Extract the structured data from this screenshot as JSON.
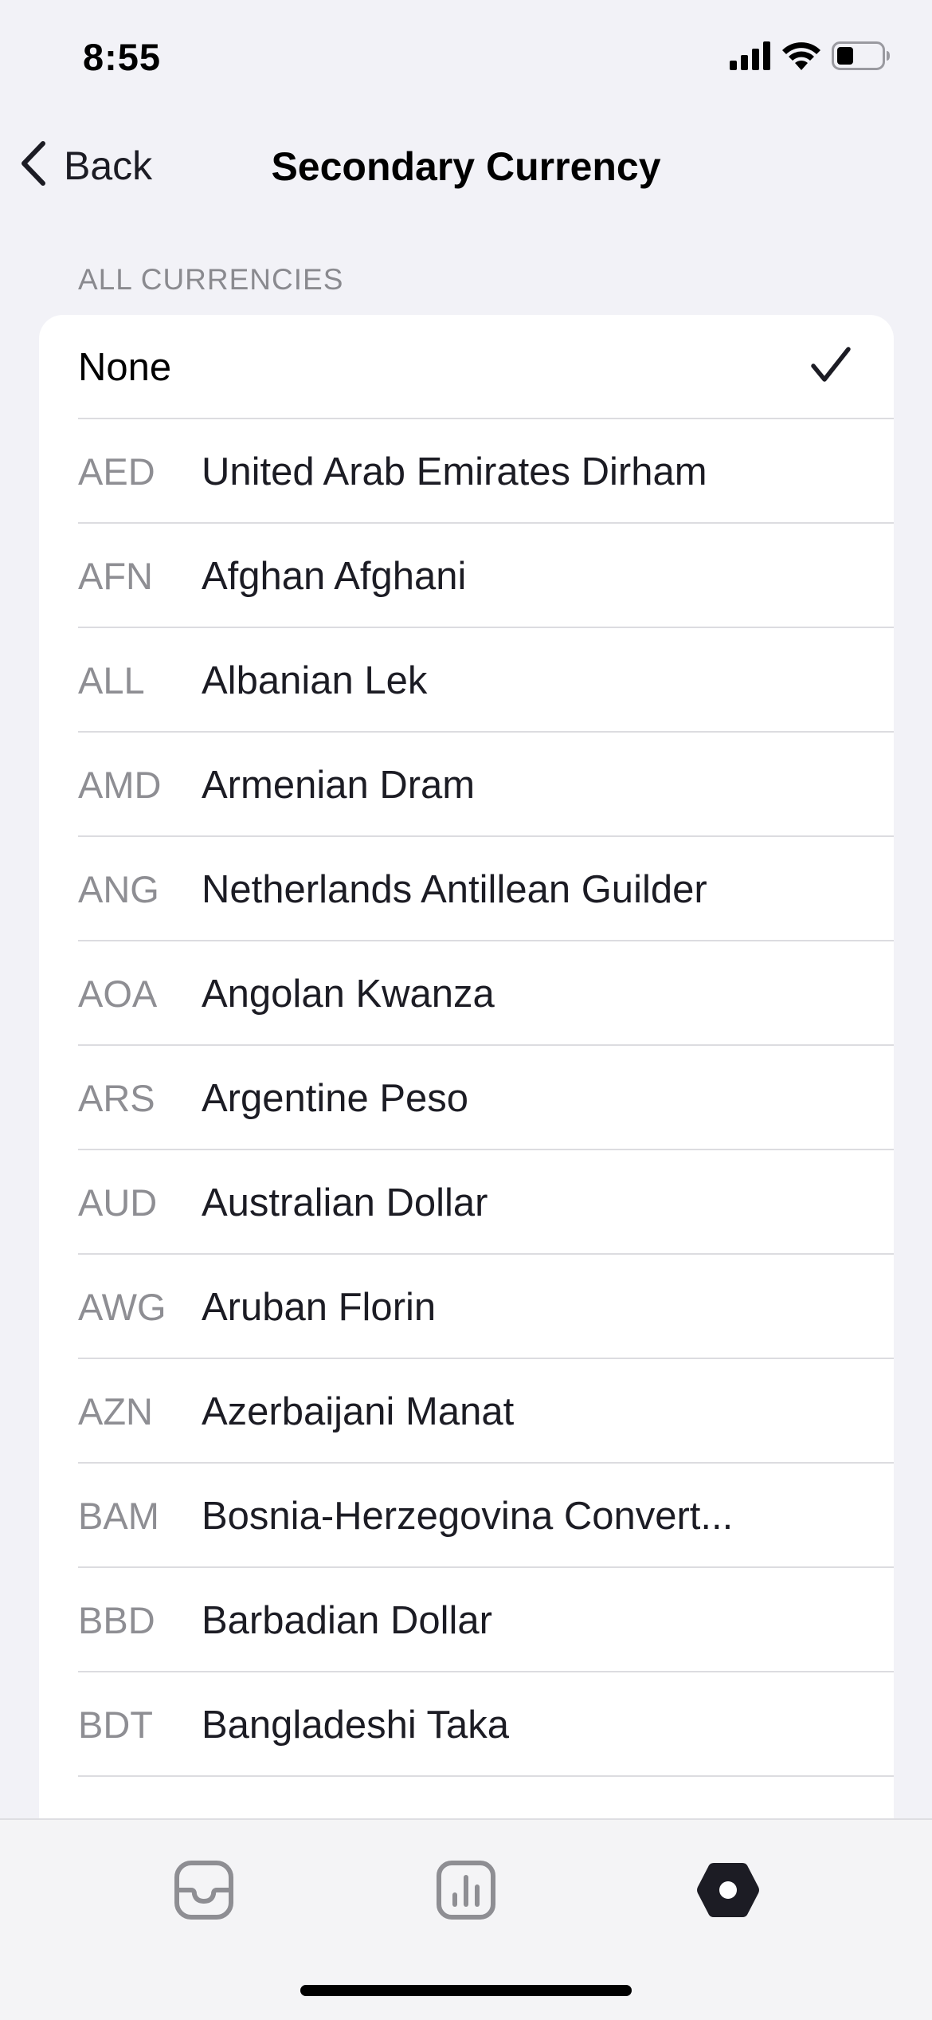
{
  "status_bar": {
    "time": "8:55"
  },
  "nav": {
    "back_label": "Back",
    "title": "Secondary Currency"
  },
  "section": {
    "header": "ALL CURRENCIES"
  },
  "none_option": {
    "label": "None",
    "selected": true
  },
  "currencies": [
    {
      "code": "AED",
      "name": "United Arab Emirates Dirham"
    },
    {
      "code": "AFN",
      "name": "Afghan Afghani"
    },
    {
      "code": "ALL",
      "name": "Albanian Lek"
    },
    {
      "code": "AMD",
      "name": "Armenian Dram"
    },
    {
      "code": "ANG",
      "name": "Netherlands Antillean Guilder"
    },
    {
      "code": "AOA",
      "name": "Angolan Kwanza"
    },
    {
      "code": "ARS",
      "name": "Argentine Peso"
    },
    {
      "code": "AUD",
      "name": "Australian Dollar"
    },
    {
      "code": "AWG",
      "name": "Aruban Florin"
    },
    {
      "code": "AZN",
      "name": "Azerbaijani Manat"
    },
    {
      "code": "BAM",
      "name": "Bosnia-Herzegovina Convert..."
    },
    {
      "code": "BBD",
      "name": "Barbadian Dollar"
    },
    {
      "code": "BDT",
      "name": "Bangladeshi Taka"
    }
  ],
  "tabs": [
    {
      "icon": "inbox-tray-icon",
      "active": false
    },
    {
      "icon": "bar-chart-icon",
      "active": false
    },
    {
      "icon": "settings-hexagon-icon",
      "active": true
    }
  ],
  "colors": {
    "background": "#f2f2f7",
    "card": "#ffffff",
    "secondary_text": "#8e8e93",
    "tab_inactive": "#8e8e93",
    "tab_active": "#1c1c24"
  }
}
